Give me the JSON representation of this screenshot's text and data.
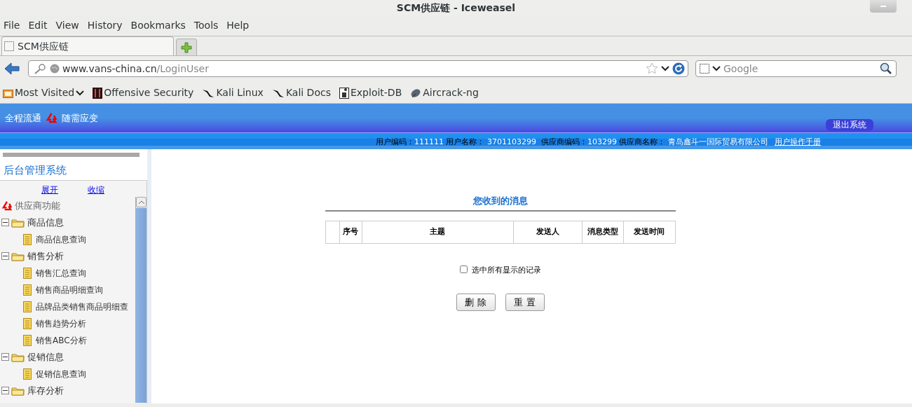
{
  "window": {
    "title": "SCM供应链 - Iceweasel"
  },
  "menu": [
    {
      "label": "File"
    },
    {
      "label": "Edit"
    },
    {
      "label": "View"
    },
    {
      "label": "History"
    },
    {
      "label": "Bookmarks"
    },
    {
      "label": "Tools"
    },
    {
      "label": "Help"
    }
  ],
  "tabs": [
    {
      "label": "SCM供应链",
      "selected": true
    }
  ],
  "address": {
    "host": "www.vans-china.cn",
    "path": "/LoginUser"
  },
  "search": {
    "placeholder": "Google"
  },
  "bookmarks": [
    {
      "label": "Most Visited",
      "kind": "folder"
    },
    {
      "label": "Offensive Security",
      "kind": "offsec"
    },
    {
      "label": "Kali Linux",
      "kind": "kali"
    },
    {
      "label": "Kali Docs",
      "kind": "kali"
    },
    {
      "label": "Exploit-DB",
      "kind": "exploit"
    },
    {
      "label": "Aircrack-ng",
      "kind": "aircrack"
    }
  ],
  "header": {
    "slogan_left": "全程流通",
    "slogan_right": "随需应变",
    "logout": "退出系统"
  },
  "user_info": [
    {
      "label": "用户编码：",
      "value": "111111"
    },
    {
      "label": " 用户名称： ",
      "value": "3701103299"
    },
    {
      "label": "  供应商编码：",
      "value": "103299"
    },
    {
      "label": " 供应商名称： ",
      "value": "青岛鑫斗一国际贸易有限公司"
    }
  ],
  "manual_link": "用户操作手册",
  "sidebar": {
    "title": "后台管理系统",
    "expand": "展开",
    "collapse": "收缩",
    "root": "供应商功能",
    "tree": [
      {
        "label": "商品信息",
        "expanded": true,
        "children": [
          {
            "label": "商品信息查询"
          }
        ]
      },
      {
        "label": "销售分析",
        "expanded": true,
        "children": [
          {
            "label": "销售汇总查询"
          },
          {
            "label": "销售商品明细查询"
          },
          {
            "label": "品牌品类销售商品明细查"
          },
          {
            "label": "销售趋势分析"
          },
          {
            "label": "销售ABC分析"
          }
        ]
      },
      {
        "label": "促销信息",
        "expanded": true,
        "children": [
          {
            "label": "促销信息查询"
          }
        ]
      },
      {
        "label": "库存分析",
        "expanded": true
      }
    ]
  },
  "messages": {
    "title": "您收到的消息",
    "columns": [
      "",
      "序号",
      "主题",
      "发送人",
      "消息类型",
      "发送时间"
    ],
    "select_all": {
      "label": "选中所有显示的记录",
      "checked": false
    },
    "buttons": [
      "删 除",
      "重 置"
    ]
  }
}
